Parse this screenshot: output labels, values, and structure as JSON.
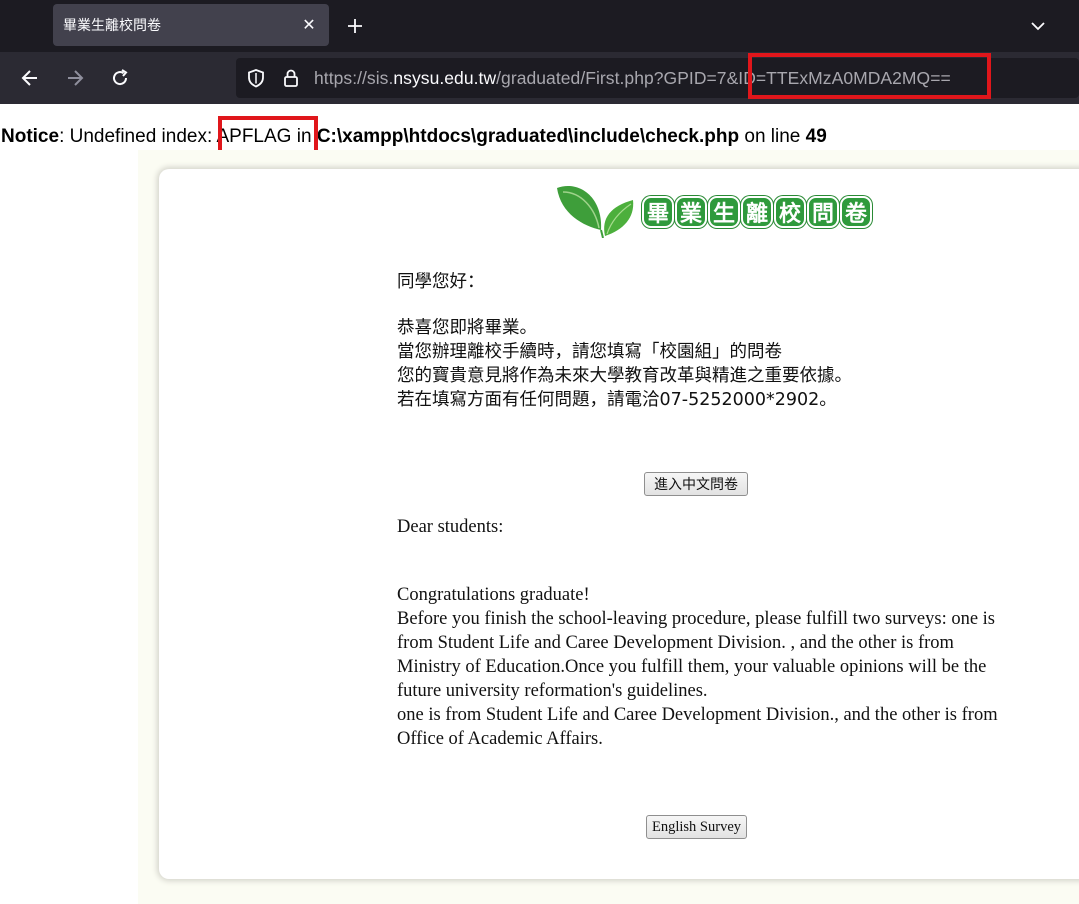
{
  "browser": {
    "tab_title": "畢業生離校問卷",
    "close_glyph": "✕",
    "new_tab_glyph": "+",
    "url_prefix": "https://sis.",
    "url_host": "nsysu.edu.tw",
    "url_suffix": "/graduated/First.php?GPID=7&ID=TTExMzA0MDA2MQ=="
  },
  "notice": {
    "label": "Notice",
    "text_before": ": Undefined index: ",
    "index": "APFLAG",
    "text_in": " in ",
    "path": "C:\\xampp\\htdocs\\graduated\\include\\check.php",
    "text_line": " on line ",
    "line": "49"
  },
  "logo": {
    "chars": [
      "畢",
      "業",
      "生",
      "離",
      "校",
      "問",
      "卷"
    ]
  },
  "chinese": {
    "greeting": "同學您好：",
    "lines": [
      "恭喜您即將畢業。",
      "當您辦理離校手續時，請您填寫「校園組」的問卷",
      "您的寶貴意見將作為未來大學教育改革與精進之重要依據。",
      "若在填寫方面有任何問題，請電洽07-5252000*2902。"
    ],
    "button": "進入中文問卷"
  },
  "english": {
    "greeting": "Dear students:",
    "lines": [
      "Congratulations graduate!",
      "Before you finish the school-leaving procedure, please fulfill two surveys: one is",
      "from Student Life and Caree Development Division. , and the other is from",
      "Ministry of Education.Once you fulfill them, your valuable opinions will be the",
      "future university reformation's guidelines.",
      "one is from Student Life and Caree Development Division., and the other is from",
      "Office of Academic Affairs."
    ],
    "button": "English Survey"
  },
  "colors": {
    "highlight": "#e0161b",
    "logo_green": "#2f9a3c"
  }
}
